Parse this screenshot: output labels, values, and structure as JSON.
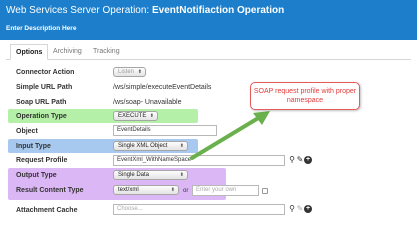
{
  "header": {
    "title_prefix": "Web Services Server Operation: ",
    "title_name": "EventNotifiaction Operation",
    "description": "Enter Description Here"
  },
  "tabs": [
    {
      "label": "Options",
      "active": true
    },
    {
      "label": "Archiving",
      "active": false
    },
    {
      "label": "Tracking",
      "active": false
    }
  ],
  "form": {
    "connector_action": {
      "label": "Connector Action",
      "value": "Listen"
    },
    "simple_url_path": {
      "label": "Simple URL Path",
      "value": "/ws/simple/executeEventDetails"
    },
    "soap_url_path": {
      "label": "Soap URL Path",
      "value": "/ws/soap- Unavailable"
    },
    "operation_type": {
      "label": "Operation Type",
      "value": "EXECUTE"
    },
    "object": {
      "label": "Object",
      "value": "EventDetails"
    },
    "input_type": {
      "label": "Input Type",
      "value": "Single XML Object"
    },
    "request_profile": {
      "label": "Request Profile",
      "value": "EventXml_WithNameSpace"
    },
    "output_type": {
      "label": "Output Type",
      "value": "Single Data"
    },
    "result_content_type": {
      "label": "Result Content Type",
      "value": "text/xml",
      "or_label": "or",
      "own_placeholder": "Enter your own"
    },
    "attachment_cache": {
      "label": "Attachment Cache",
      "placeholder": "Choose..."
    }
  },
  "annotation": {
    "callout_text": "SOAP request profile with proper namespace",
    "callout_color": "#e23b3b",
    "arrow_color": "#6ab04c"
  },
  "highlight_colors": {
    "green": "#b5f0a8",
    "blue": "#a8c9ef",
    "purple": "#dcb7f5"
  },
  "icons": [
    "search-icon",
    "edit-icon",
    "add-icon"
  ]
}
